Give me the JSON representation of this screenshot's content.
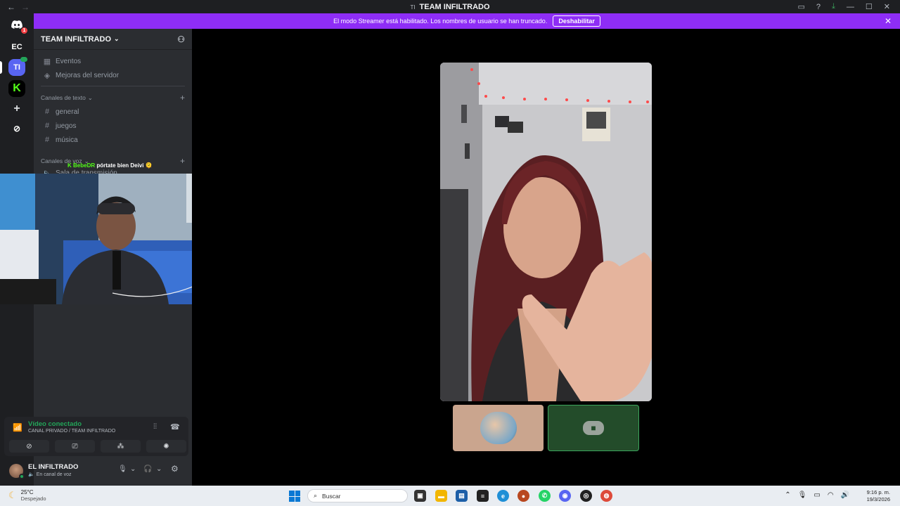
{
  "window": {
    "title_icon": "TI",
    "title": "TEAM INFILTRADO",
    "back": "←",
    "forward": "→",
    "controls": {
      "inbox": "▭",
      "help": "?",
      "download": "⤓",
      "minimize": "—",
      "maximize": "☐",
      "close": "✕"
    }
  },
  "streamer_banner": {
    "text": "El modo Streamer está habilitado. Los nombres de usuario se han truncado.",
    "button": "Deshabilitar",
    "close": "✕"
  },
  "guilds": {
    "home_badge": "1",
    "items": [
      "EC",
      "TI",
      "K",
      "+",
      "⊘"
    ]
  },
  "server": {
    "name": "TEAM INFILTRADO",
    "events": "Eventos",
    "boosts": "Mejoras del servidor",
    "text_category": "Canales de texto",
    "text_channels": [
      "general",
      "juegos",
      "música"
    ],
    "voice_category": "Canales de voz",
    "voice_channels": [
      "Sala de transmisión"
    ]
  },
  "overlay": {
    "user": "BebeDR",
    "message": "pórtate bien Deivi 🫠"
  },
  "voice": {
    "status": "Vídeo conectado",
    "channel": "CANAL PRIVADO / TEAM INFILTRADO",
    "buttons": [
      "camera-off-icon",
      "screen-share-icon",
      "activities-icon",
      "soundboard-icon"
    ]
  },
  "user": {
    "name": "EL INFILTRADO",
    "status": "En canal de voz"
  },
  "taskbar": {
    "temp": "25°C",
    "weather": "Despejado",
    "search_placeholder": "Buscar",
    "time": "9:16 p. m.",
    "date": "19/3/2026"
  },
  "colors": {
    "streamer_purple": "#8e2df6",
    "connected_green": "#23a559",
    "accent_blurple": "#5865f2"
  }
}
